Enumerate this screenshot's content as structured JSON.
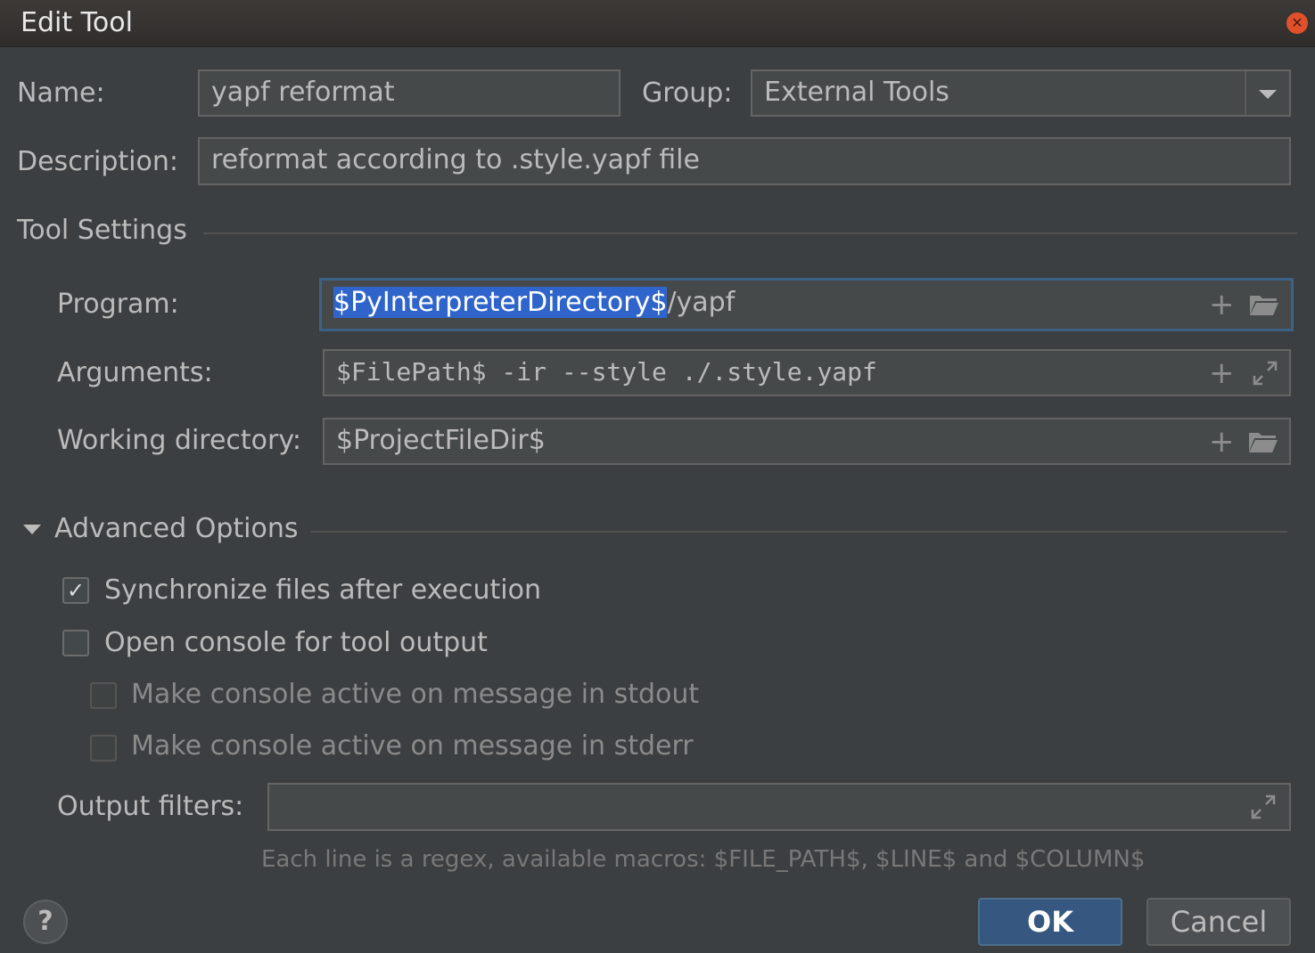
{
  "window": {
    "title": "Edit Tool"
  },
  "form": {
    "name_label": "Name:",
    "name_value": "yapf reformat",
    "group_label": "Group:",
    "group_value": "External Tools",
    "description_label": "Description:",
    "description_value": "reformat according to .style.yapf file"
  },
  "tool_settings": {
    "heading": "Tool Settings",
    "program_label": "Program:",
    "program_selected": "$PyInterpreterDirectory$",
    "program_rest": "/yapf",
    "arguments_label": "Arguments:",
    "arguments_value": "$FilePath$ -ir --style ./.style.yapf",
    "workdir_label": "Working directory:",
    "workdir_value": "$ProjectFileDir$",
    "icons": {
      "insert_macro": "plus-icon",
      "browse": "folder-icon",
      "expand": "expand-icon"
    }
  },
  "advanced": {
    "heading": "Advanced Options",
    "options": [
      {
        "label": "Synchronize files after execution",
        "checked": true,
        "enabled": true
      },
      {
        "label": "Open console for tool output",
        "checked": false,
        "enabled": true
      },
      {
        "label": "Make console active on message in stdout",
        "checked": false,
        "enabled": false
      },
      {
        "label": "Make console active on message in stderr",
        "checked": false,
        "enabled": false
      }
    ],
    "output_filters_label": "Output filters:",
    "output_filters_value": "",
    "hint": "Each line is a regex, available macros: $FILE_PATH$, $LINE$ and $COLUMN$"
  },
  "buttons": {
    "help": "?",
    "ok": "OK",
    "cancel": "Cancel"
  },
  "colors": {
    "background": "#3c3f41",
    "selection": "#2f65ca",
    "ok_button": "#365880",
    "close": "#e0512b"
  }
}
